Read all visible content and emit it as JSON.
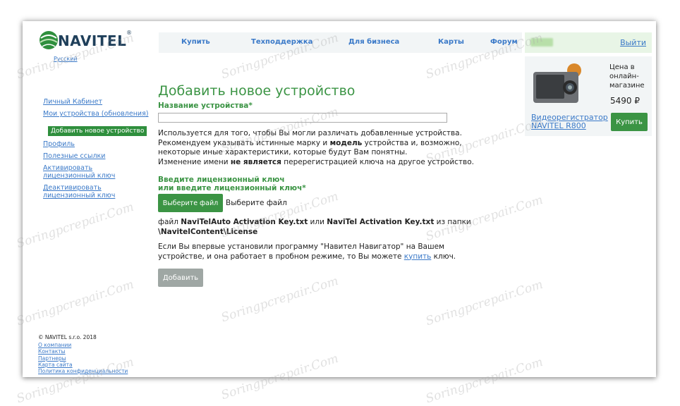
{
  "header": {
    "logo_text": "NAVITEL",
    "logo_reg": "®",
    "language": "Русский"
  },
  "topnav": {
    "items": [
      "Купить",
      "Техподдержка",
      "Для бизнеса",
      "Карты",
      "Форум"
    ]
  },
  "user": {
    "logout": "Выйти"
  },
  "product": {
    "price_label": "Цена в онлайн-магазине",
    "price_value": "5490 ₽",
    "name": "Видеорегистратор NAVITEL R800",
    "buy_label": "Купить"
  },
  "sidebar": {
    "items": [
      "Личный Кабинет",
      "Мои устройства (обновления)",
      "Добавить новое устройство",
      "Профиль",
      "Полезные ссылки",
      "Активировать лицензионный ключ",
      "Деактивировать лицензионный ключ"
    ]
  },
  "main": {
    "title": "Добавить новое устройство",
    "device_name_label": "Название устройства*",
    "device_name_value": "",
    "desc1": "Используется для того, чтобы Вы могли различать добавленные устройства.",
    "desc2_pre": "Рекомендуем указывать истинные марку и ",
    "desc2_bold": "модель",
    "desc2_post": " устройства и, возможно, некоторые иные характеристики, которые будут Вам понятны.",
    "desc3_pre": "Изменение имени ",
    "desc3_bold": "не является",
    "desc3_post": " перерегистрацией ключа на другое устройство.",
    "key_label_1": "Введите лицензионный ключ",
    "key_label_2": "или введите лицензионный ключ*",
    "file_button": "Выберите файл",
    "file_status": "Выберите файл",
    "file_info_pre": "файл ",
    "file_info_b1": "NaviTelAuto Activation Key.txt",
    "file_info_mid": " или ",
    "file_info_b2": "NaviTel Activation Key.txt",
    "file_info_mid2": " из папки ",
    "file_info_b3": "\\NavitelContent\\License",
    "trial_pre": "Если Вы впервые установили программу \"Навител Навигатор\" на Вашем устройстве, и она работает в пробном режиме, то Вы можете ",
    "trial_link": "купить",
    "trial_post": " ключ.",
    "add_button": "Добавить"
  },
  "footer": {
    "copyright": "© NAVITEL s.r.o. 2018",
    "links": [
      "О компании",
      "Контакты",
      "Партнеры",
      "Карта сайта",
      "Политика конфиденциальности"
    ]
  },
  "watermark": "Soringpcrepair.Com",
  "colors": {
    "brand_green": "#3b9444",
    "link_blue": "#3a79c8",
    "active_green": "#2f8f3d",
    "disabled_gray": "#9fa7a4"
  }
}
